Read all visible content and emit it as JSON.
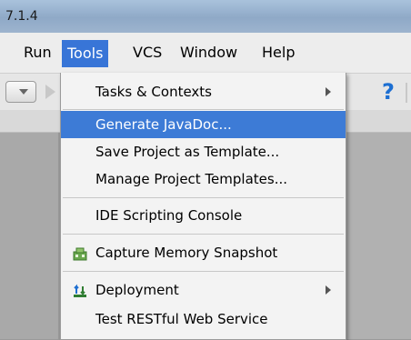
{
  "titlebar": {
    "text": "7.1.4"
  },
  "menubar": {
    "run": "Run",
    "tools": "Tools",
    "vcs": "VCS",
    "window": "Window",
    "help": "Help"
  },
  "toolbar": {
    "help_glyph": "?"
  },
  "tools_menu": {
    "tasks": "Tasks & Contexts",
    "generate_javadoc": "Generate JavaDoc...",
    "save_template": "Save Project as Template...",
    "manage_templates": "Manage Project Templates...",
    "ide_console": "IDE Scripting Console",
    "capture_memory": "Capture Memory Snapshot",
    "deployment": "Deployment",
    "test_rest": "Test RESTful Web Service"
  },
  "icons": {
    "memory": "memory-snapshot-icon",
    "deployment": "deployment-icon"
  },
  "colors": {
    "selection": "#3d7bd6",
    "help_blue": "#1d6fd2"
  }
}
